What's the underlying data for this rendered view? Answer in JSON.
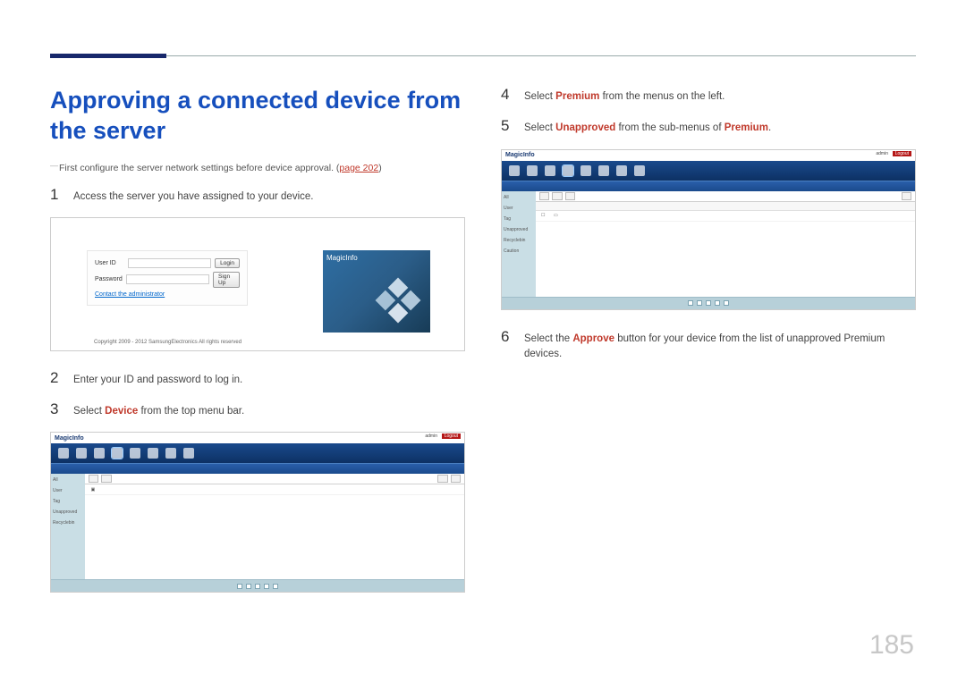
{
  "page_number": "185",
  "heading": "Approving a connected device from the server",
  "note": {
    "text": "First configure the server network settings before device approval. (",
    "link_label": "page 202",
    "suffix": ")"
  },
  "steps": {
    "s1": {
      "num": "1",
      "text": "Access the server you have assigned to your device."
    },
    "s2": {
      "num": "2",
      "text": "Enter your ID and password to log in."
    },
    "s3": {
      "num": "3",
      "pre": "Select ",
      "kw": "Device",
      "post": " from the top menu bar."
    },
    "s4": {
      "num": "4",
      "pre": "Select ",
      "kw": "Premium",
      "post": " from the menus on the left."
    },
    "s5": {
      "num": "5",
      "pre": "Select ",
      "kw": "Unapproved",
      "post_a": " from the sub-menus of ",
      "kw2": "Premium",
      "post_b": "."
    },
    "s6": {
      "num": "6",
      "pre": "Select the ",
      "kw": "Approve",
      "post": " button for your device from the list of unapproved Premium devices."
    }
  },
  "login": {
    "user_label": "User ID",
    "pass_label": "Password",
    "login_btn": "Login",
    "signup_btn": "Sign Up",
    "contact": "Contact the administrator",
    "copyright": "Copyright 2009 - 2012 SamsungElectronics All rights reserved",
    "brand": "MagicInfo"
  },
  "app": {
    "brand": "MagicInfo",
    "sidebar": {
      "i1": "All",
      "i2": "User",
      "i3": "Tag",
      "i4": "Unapproved",
      "i5": "Recyclebin",
      "i6": "Caution"
    },
    "logout": "Logout",
    "user": "admin"
  }
}
